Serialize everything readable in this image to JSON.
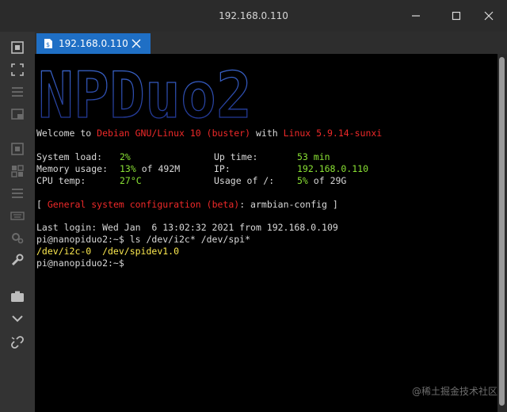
{
  "window": {
    "title": "192.168.0.110"
  },
  "tab": {
    "label": "192.168.0.110"
  },
  "terminal": {
    "banner": "NPDuo2",
    "welcome": {
      "prefix": "Welcome to ",
      "os": "Debian GNU/Linux 10 (buster)",
      "mid": " with ",
      "kernel": "Linux 5.9.14-sunxi"
    },
    "stats": {
      "system_load_label": "System load:",
      "system_load_value": "2%",
      "up_time_label": "Up time:",
      "up_time_value": "53 min",
      "memory_label": "Memory usage:",
      "memory_value": "13%",
      "memory_total": "of 492M",
      "ip_label": "IP:",
      "ip_value": "192.168.0.110",
      "cpu_temp_label": "CPU temp:",
      "cpu_temp_value": "27°C",
      "usage_label": "Usage of /:",
      "usage_value": "5%",
      "usage_total": "of 29G"
    },
    "config_line": {
      "open": "[ ",
      "text": "General system configuration (beta)",
      "sep": ": ",
      "cmd": "armbian-config",
      "close": " ]"
    },
    "last_login": "Last login: Wed Jan  6 13:02:32 2021 from 192.168.0.109",
    "prompt1": "pi@nanopiduo2:~$ ls /dev/i2c* /dev/spi*",
    "output": "/dev/i2c-0  /dev/spidev1.0",
    "prompt2": "pi@nanopiduo2:~$"
  },
  "watermark": "@稀土掘金技术社区",
  "colors": {
    "tab_active": "#1f6fc5",
    "green": "#8ae234",
    "red": "#ef2929",
    "yellow": "#fce94f"
  }
}
